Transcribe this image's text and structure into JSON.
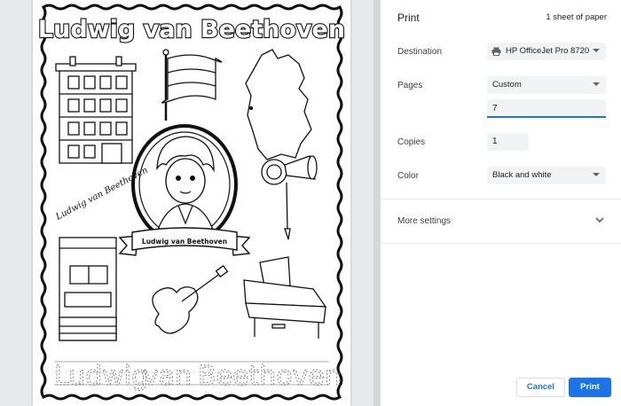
{
  "preview": {
    "banner_title": "Ludwig van Beethoven",
    "portrait_banner": "Ludwig van Beethoven",
    "signature": "Ludwig van Beethoven",
    "trace_words": [
      "Ludwig",
      "van",
      "Beethoven"
    ]
  },
  "panel": {
    "title": "Print",
    "sheet_count": "1 sheet of paper",
    "destination": {
      "label": "Destination",
      "value": "HP OfficeJet Pro 8720",
      "icon": "printer-icon"
    },
    "pages": {
      "label": "Pages",
      "value": "Custom",
      "custom_range": "7"
    },
    "copies": {
      "label": "Copies",
      "value": "1"
    },
    "color": {
      "label": "Color",
      "value": "Black and white"
    },
    "more_settings": "More settings",
    "cancel": "Cancel",
    "print": "Print"
  },
  "colors": {
    "accent": "#1a73e8",
    "field_bg": "#f1f3f4",
    "preview_bg": "#e8e9eb"
  }
}
